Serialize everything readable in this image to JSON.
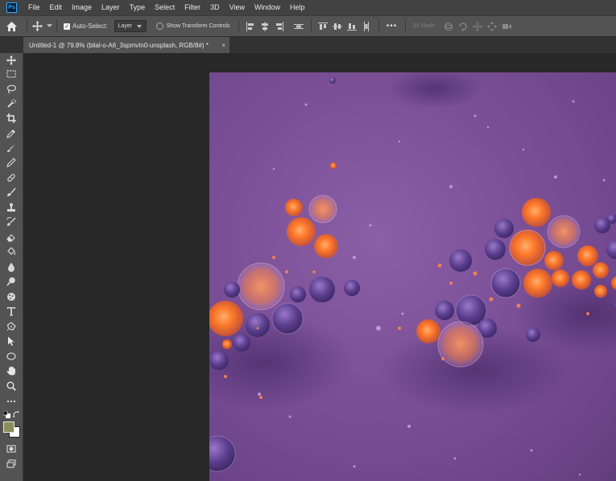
{
  "app": {
    "logo_text": "Ps"
  },
  "menu": [
    "File",
    "Edit",
    "Image",
    "Layer",
    "Type",
    "Select",
    "Filter",
    "3D",
    "View",
    "Window",
    "Help"
  ],
  "options_bar": {
    "auto_select_label": "Auto-Select:",
    "auto_select_checked": true,
    "layer_select_value": "Layer",
    "show_transform_label": "Show Transform Controls",
    "more_label": "•••",
    "mode_3d_label": "3D Mode:"
  },
  "document_tab": {
    "title": "Untitled-1 @ 79.8% (bilal-o-A6_3spmvIn0-unsplash, RGB/8#) *",
    "close": "×"
  },
  "tools": [
    "move",
    "marquee",
    "lasso",
    "quick-select",
    "crop",
    "eyedropper",
    "healing-brush",
    "brush",
    "clone-stamp",
    "history-brush",
    "eraser",
    "gradient",
    "blur",
    "dodge",
    "pen",
    "type",
    "path-select",
    "shape",
    "hand",
    "zoom",
    "more"
  ],
  "colors": {
    "foreground": "#8a8f5a",
    "background": "#ffffff",
    "canvas_bg": "#282828",
    "accent": "#31a8ff"
  }
}
